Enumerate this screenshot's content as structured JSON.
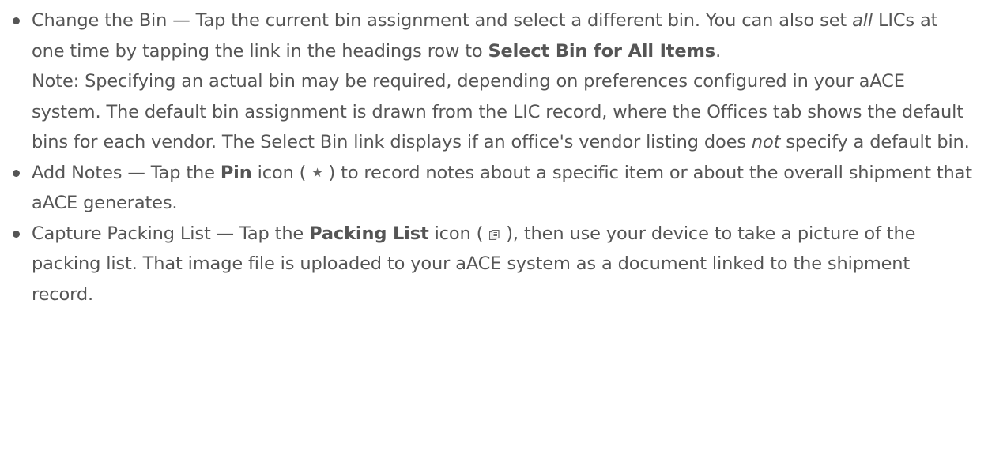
{
  "items": [
    {
      "lead": "Change the Bin",
      "dash": " — ",
      "t1": "Tap the current bin assignment and select a different bin. You can also set ",
      "em1": "all",
      "t2": " LICs at one time by tapping the link in the headings row to ",
      "strong1": "Select Bin for All Items",
      "t3": ".",
      "note_a": "Note: Specifying an actual bin may be required, depending on preferences configured in your aACE system. The default bin assignment is drawn from the LIC record, where the Offices tab shows the default bins for each vendor. The Select Bin link displays if an office's vendor listing does ",
      "note_em": "not",
      "note_b": " specify a default bin."
    },
    {
      "lead": "Add Notes",
      "dash": " — ",
      "t1": "Tap the ",
      "strong1": "Pin",
      "t2": " icon (",
      "icon": "pin-icon",
      "t3": ") to record notes about a specific item or about the overall shipment that aACE generates."
    },
    {
      "lead": "Capture Packing List",
      "dash": " — ",
      "t1": "Tap the ",
      "strong1": "Packing List",
      "t2": " icon (",
      "icon": "packing-list-icon",
      "t3": "), then use your device to take a picture of the packing list. That image file is uploaded to your aACE system as a document linked to the shipment record."
    }
  ],
  "colors": {
    "text": "#555555",
    "background": "#ffffff"
  }
}
